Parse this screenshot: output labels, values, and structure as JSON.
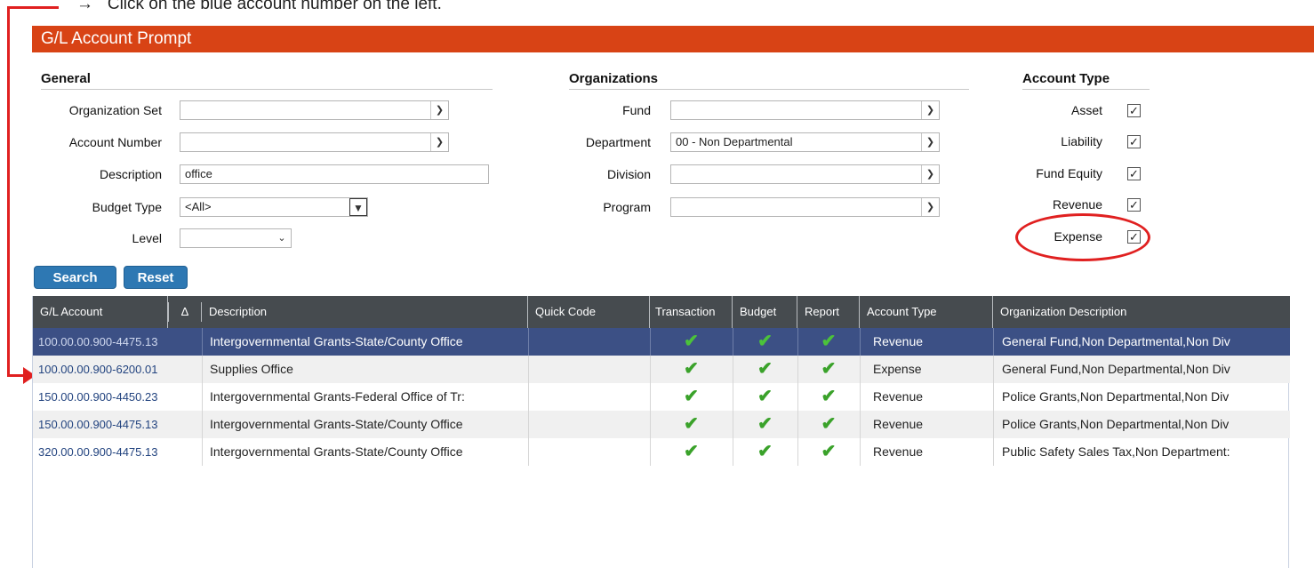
{
  "instruction": {
    "arrow": "→",
    "text": "Click on the blue account number on the left."
  },
  "title": "G/L Account Prompt",
  "general": {
    "heading": "General",
    "organization_set_label": "Organization Set",
    "organization_set_value": "",
    "account_number_label": "Account Number",
    "account_number_value": "",
    "description_label": "Description",
    "description_value": "office",
    "budget_type_label": "Budget Type",
    "budget_type_value": "<All>",
    "level_label": "Level",
    "level_value": ""
  },
  "organizations": {
    "heading": "Organizations",
    "fund_label": "Fund",
    "fund_value": "",
    "department_label": "Department",
    "department_value": "00 - Non Departmental",
    "division_label": "Division",
    "division_value": "",
    "program_label": "Program",
    "program_value": ""
  },
  "account_type": {
    "heading": "Account Type",
    "items": [
      {
        "label": "Asset",
        "checked": true
      },
      {
        "label": "Liability",
        "checked": true
      },
      {
        "label": "Fund Equity",
        "checked": true
      },
      {
        "label": "Revenue",
        "checked": true
      },
      {
        "label": "Expense",
        "checked": true
      }
    ]
  },
  "buttons": {
    "search": "Search",
    "reset": "Reset"
  },
  "table": {
    "columns": {
      "gl_account": "G/L Account",
      "sort_indicator": "Δ",
      "description": "Description",
      "quick_code": "Quick Code",
      "transaction": "Transaction",
      "budget": "Budget",
      "report": "Report",
      "account_type": "Account Type",
      "organization_description": "Organization Description"
    },
    "check_glyph": "✔",
    "rows": [
      {
        "account": "100.00.00.900-4475.13",
        "description": "Intergovernmental Grants-State/County Office",
        "quick_code": "",
        "account_type": "Revenue",
        "org": "General Fund,Non Departmental,Non Div"
      },
      {
        "account": "100.00.00.900-6200.01",
        "description": "Supplies Office",
        "quick_code": "",
        "account_type": "Expense",
        "org": "General Fund,Non Departmental,Non Div"
      },
      {
        "account": "150.00.00.900-4450.23",
        "description": "Intergovernmental Grants-Federal Office of Tr:",
        "quick_code": "",
        "account_type": "Revenue",
        "org": "Police Grants,Non Departmental,Non Div"
      },
      {
        "account": "150.00.00.900-4475.13",
        "description": "Intergovernmental Grants-State/County Office",
        "quick_code": "",
        "account_type": "Revenue",
        "org": "Police Grants,Non Departmental,Non Div"
      },
      {
        "account": "320.00.00.900-4475.13",
        "description": "Intergovernmental Grants-State/County Office",
        "quick_code": "",
        "account_type": "Revenue",
        "org": "Public Safety Sales Tax,Non Department:"
      }
    ]
  },
  "colors": {
    "title_bar": "#d84315",
    "button": "#2e78b3",
    "selected_row": "#3c5085",
    "header": "#464b4f",
    "check": "#3aa22a",
    "annotation": "#e02020"
  }
}
